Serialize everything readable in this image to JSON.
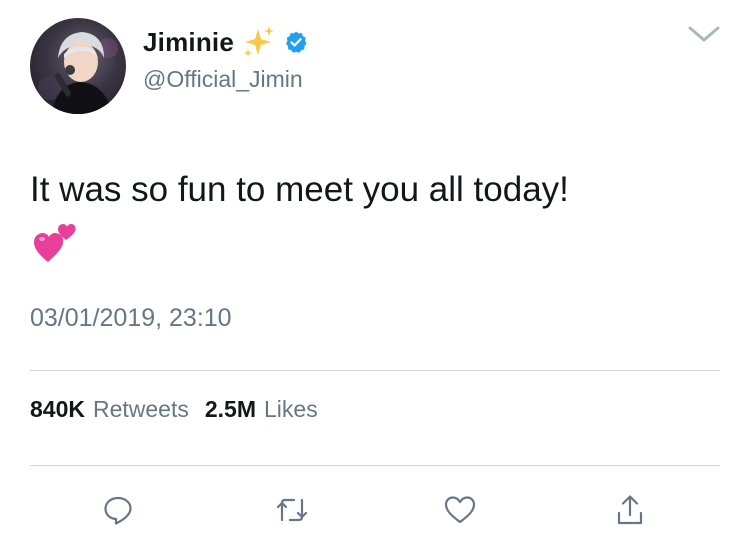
{
  "author": {
    "display_name": "Jiminie",
    "handle": "@Official_Jimin",
    "verified": true,
    "name_emoji": "sparkles-icon"
  },
  "tweet": {
    "text": "It was so fun to meet you all today!",
    "emoji": "two-hearts-icon",
    "timestamp": "03/01/2019, 23:10"
  },
  "stats": {
    "retweets_count": "840K",
    "retweets_label": "Retweets",
    "likes_count": "2.5M",
    "likes_label": "Likes"
  },
  "actions": [
    {
      "icon": "reply-icon"
    },
    {
      "icon": "retweet-icon"
    },
    {
      "icon": "like-icon"
    },
    {
      "icon": "share-icon"
    }
  ],
  "colors": {
    "text_primary": "#14171a",
    "text_secondary": "#657786",
    "verified_blue": "#1da1f2",
    "divider": "#d3d7da",
    "heart_pink": "#e8409a"
  }
}
